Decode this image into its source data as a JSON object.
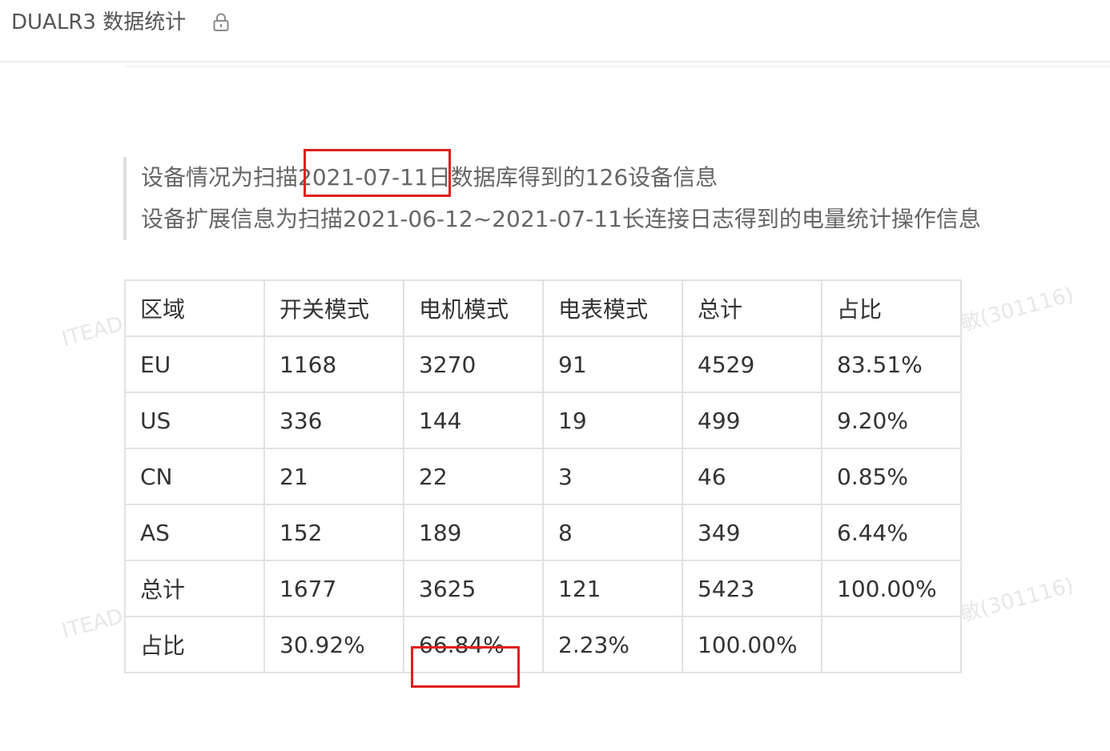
{
  "header": {
    "title": "DUALR3 数据统计",
    "lock_icon": "lock-icon"
  },
  "watermark": {
    "left_text": "ITEAD",
    "right_text": "敏(301116)"
  },
  "quote": {
    "line1": "设备情况为扫描2021-07-11日数据库得到的126设备信息",
    "line2": "设备扩展信息为扫描2021-06-12~2021-07-11长连接日志得到的电量统计操作信息"
  },
  "highlight_color": "#e0201e",
  "table": {
    "headers": [
      "区域",
      "开关模式",
      "电机模式",
      "电表模式",
      "总计",
      "占比"
    ],
    "rows": [
      [
        "EU",
        "1168",
        "3270",
        "91",
        "4529",
        "83.51%"
      ],
      [
        "US",
        "336",
        "144",
        "19",
        "499",
        "9.20%"
      ],
      [
        "CN",
        "21",
        "22",
        "3",
        "46",
        "0.85%"
      ],
      [
        "AS",
        "152",
        "189",
        "8",
        "349",
        "6.44%"
      ],
      [
        "总计",
        "1677",
        "3625",
        "121",
        "5423",
        "100.00%"
      ],
      [
        "占比",
        "30.92%",
        "66.84%",
        "2.23%",
        "100.00%",
        ""
      ]
    ]
  }
}
